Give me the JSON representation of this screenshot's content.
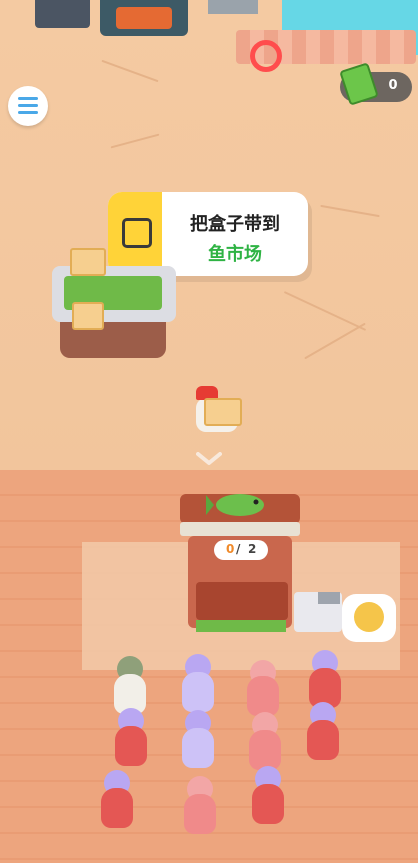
{
  "hud": {
    "menu_icon": "list-icon",
    "cash_icon": "cash-bundle-icon",
    "cash_count": "0"
  },
  "task": {
    "line1": "把盒子带到",
    "line2": "鱼市场",
    "accent_color": "#2fb344",
    "badge_color": "#ffd338"
  },
  "stall": {
    "progress_current": "0",
    "progress_separator": "/",
    "progress_total": "2"
  },
  "emote": {
    "icon": "angry-face-icon"
  }
}
